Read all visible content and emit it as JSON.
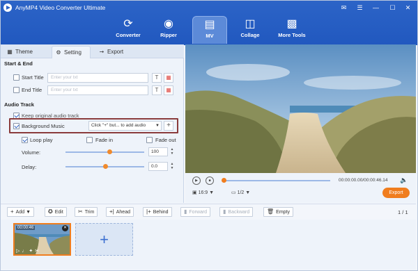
{
  "app": {
    "title": "AnyMP4 Video Converter Ultimate"
  },
  "window_controls": [
    "feedback-icon",
    "menu-icon",
    "minimize-icon",
    "maximize-icon",
    "close-icon"
  ],
  "tabs": [
    {
      "label": "Converter",
      "icon": "converter-icon"
    },
    {
      "label": "Ripper",
      "icon": "ripper-icon"
    },
    {
      "label": "MV",
      "icon": "mv-icon",
      "active": true
    },
    {
      "label": "Collage",
      "icon": "collage-icon"
    },
    {
      "label": "More Tools",
      "icon": "toolbox-icon"
    }
  ],
  "subtabs": [
    {
      "label": "Theme",
      "icon": "grid-icon"
    },
    {
      "label": "Setting",
      "icon": "gear-icon",
      "active": true
    },
    {
      "label": "Export",
      "icon": "export-icon"
    }
  ],
  "start_end": {
    "title": "Start & End",
    "start_title": {
      "label": "Start Title",
      "placeholder": "Enter your txt"
    },
    "end_title": {
      "label": "End Title",
      "placeholder": "Enter your txt"
    }
  },
  "audio": {
    "title": "Audio Track",
    "keep_original": "Keep original audio track",
    "background_music": "Background Music",
    "music_dropdown": "Click \"+\" but... to add audio",
    "add_label": "+",
    "loop_play": "Loop play",
    "fade_in": "Fade in",
    "fade_out": "Fade out",
    "volume_label": "Volume:",
    "volume_value": "100",
    "volume_fraction": 0.56,
    "delay_label": "Delay:",
    "delay_value": "0.0",
    "delay_fraction": 0.5
  },
  "player": {
    "time": "00:00:00.00/00:00:46.14",
    "aspect": "16:9",
    "zoom": "1/2",
    "export_label": "Export"
  },
  "toolbar": {
    "add": "Add",
    "edit": "Edit",
    "trim": "Trim",
    "ahead": "Ahead",
    "behind": "Behind",
    "forward": "Forward",
    "backward": "Backward",
    "empty": "Empty",
    "page": "1",
    "page_total": "1"
  },
  "clip": {
    "duration": "00:00:46"
  },
  "colors": {
    "accent": "#2158bf",
    "export": "#f07d1e",
    "highlight": "#8a3b3b"
  }
}
